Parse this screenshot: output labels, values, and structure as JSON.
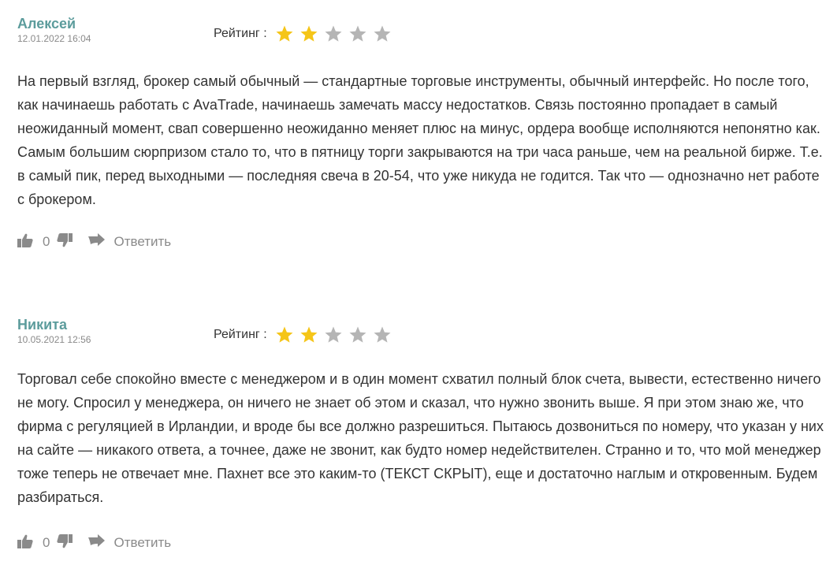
{
  "reviews": [
    {
      "author": "Алексей",
      "date": "12.01.2022 16:04",
      "rating_label": "Рейтинг :",
      "rating": 2,
      "rating_max": 5,
      "text": "На первый взгляд, брокер самый обычный — стандартные торговые инструменты, обычный интерфейс. Но после того, как начинаешь работать с AvaTrade, начинаешь замечать массу недостатков. Связь постоянно пропадает в самый неожиданный момент, свап совершенно неожиданно меняет плюс на минус, ордера вообще исполняются непонятно как. Самым большим сюрпризом стало то, что в пятницу торги закрываются на три часа раньше, чем на реальной бирже. Т.е. в самый пик, перед выходными — последняя свеча в 20-54, что уже никуда не годится. Так что — однозначно нет работе с брокером.",
      "likes": "0",
      "reply_label": "Ответить"
    },
    {
      "author": "Никита",
      "date": "10.05.2021 12:56",
      "rating_label": "Рейтинг :",
      "rating": 2,
      "rating_max": 5,
      "text": "Торговал себе спокойно вместе с менеджером и в один момент схватил полный блок счета, вывести, естественно ничего не могу. Спросил у менеджера, он ничего не знает об этом и сказал, что нужно звонить выше. Я при этом знаю же, что фирма с регуляцией в Ирландии, и вроде бы все должно разрешиться. Пытаюсь дозвониться по номеру, что указан у них на сайте — никакого ответа, а точнее, даже не звонит, как будто номер недействителен. Странно и то, что мой менеджер тоже теперь не отвечает мне. Пахнет все это каким-то (ТЕКСТ СКРЫТ), еще и достаточно наглым и откровенным. Будем разбираться.",
      "likes": "0",
      "reply_label": "Ответить"
    }
  ],
  "icons": {
    "star_filled": "star-filled-icon",
    "star_empty": "star-empty-icon",
    "like": "thumbs-up-icon",
    "dislike": "thumbs-down-icon",
    "reply": "reply-arrow-icon"
  },
  "colors": {
    "author": "#5c9c9c",
    "star_filled": "#f5c518",
    "star_empty": "#b5b5b5",
    "muted": "#8a8a8a",
    "text": "#333333"
  }
}
